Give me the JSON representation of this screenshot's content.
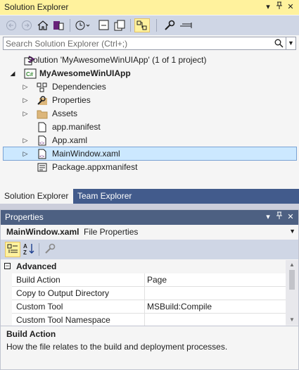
{
  "solution_explorer": {
    "title": "Solution Explorer",
    "title_buttons": {
      "dropdown": "▾",
      "pin": "⊓",
      "close": "✕"
    },
    "toolbar": {
      "buttons": [
        "back-icon",
        "forward-icon",
        "home-icon",
        "switch-views-icon",
        "history-icon",
        "collapse-all-icon",
        "show-all-files-icon",
        "sync-active-icon",
        "properties-icon",
        "preview-icon"
      ]
    },
    "search": {
      "placeholder": "Search Solution Explorer (Ctrl+;)",
      "value": ""
    },
    "tree": [
      {
        "label": "Solution 'MyAwesomeWinUIApp' (1 of 1 project)",
        "icon": "solution-icon",
        "expander": "",
        "bold": false,
        "selected": false
      },
      {
        "label": "MyAwesomeWinUIApp",
        "icon": "csharp-project-icon",
        "expander": "◢",
        "bold": true,
        "selected": false
      },
      {
        "label": "Dependencies",
        "icon": "dependencies-icon",
        "expander": "▷",
        "bold": false,
        "selected": false
      },
      {
        "label": "Properties",
        "icon": "wrench-icon",
        "expander": "▷",
        "bold": false,
        "selected": false
      },
      {
        "label": "Assets",
        "icon": "folder-icon",
        "expander": "▷",
        "bold": false,
        "selected": false
      },
      {
        "label": "app.manifest",
        "icon": "file-icon",
        "expander": "",
        "bold": false,
        "selected": false
      },
      {
        "label": "App.xaml",
        "icon": "xaml-file-icon",
        "expander": "▷",
        "bold": false,
        "selected": false
      },
      {
        "label": "MainWindow.xaml",
        "icon": "xaml-file-icon",
        "expander": "▷",
        "bold": false,
        "selected": true
      },
      {
        "label": "Package.appxmanifest",
        "icon": "manifest-icon",
        "expander": "",
        "bold": false,
        "selected": false
      }
    ],
    "tabs": [
      {
        "label": "Solution Explorer",
        "active": true
      },
      {
        "label": "Team Explorer",
        "active": false
      }
    ]
  },
  "properties": {
    "title": "Properties",
    "title_buttons": {
      "dropdown": "▾",
      "pin": "⊓",
      "close": "✕"
    },
    "object_name": "MainWindow.xaml",
    "object_type": "File Properties",
    "category": {
      "label": "Advanced",
      "toggle": "−"
    },
    "rows": [
      {
        "name": "Build Action",
        "value": "Page"
      },
      {
        "name": "Copy to Output Directory",
        "value": ""
      },
      {
        "name": "Custom Tool",
        "value": "MSBuild:Compile"
      },
      {
        "name": "Custom Tool Namespace",
        "value": ""
      }
    ],
    "description": {
      "title": "Build Action",
      "text": "How the file relates to the build and deployment processes."
    }
  },
  "colors": {
    "title_active_bg": "#fff29d",
    "title_inactive_bg": "#4d6082",
    "toolbar_bg": "#cfd6e5",
    "tab_strip_bg": "#425b8c",
    "selection_bg": "#cce8ff",
    "csharp_green": "#388a34",
    "xaml_purple": "#68217a",
    "folder_yellow": "#dcb67a"
  }
}
